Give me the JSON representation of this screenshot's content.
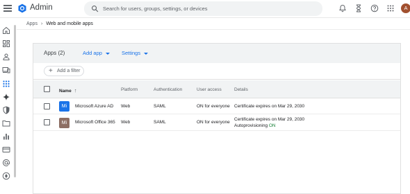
{
  "header": {
    "menu_icon": "hamburger-icon",
    "logo_icon": "google-admin-logo",
    "title": "Admin",
    "search_placeholder": "Search for users, groups, settings, or devices",
    "icons": [
      "notifications-icon",
      "hourglass-icon",
      "help-icon",
      "apps-grid-icon"
    ],
    "avatar_initial": "A"
  },
  "rail": {
    "items": [
      "home-icon",
      "dashboard-icon",
      "users-icon",
      "devices-icon",
      "apps-icon",
      "generative-ai-icon",
      "security-icon",
      "folder-icon",
      "reporting-icon",
      "billing-icon",
      "account-icon",
      "rules-icon"
    ],
    "active_index": 4
  },
  "breadcrumb": {
    "parent": "Apps",
    "current": "Web and mobile apps"
  },
  "card": {
    "apps_count_label": "Apps (2)",
    "add_app_label": "Add app",
    "settings_label": "Settings",
    "add_filter_label": "Add a filter"
  },
  "table": {
    "columns": {
      "name": "Name",
      "platform": "Platform",
      "authentication": "Authentication",
      "user_access": "User access",
      "details": "Details"
    },
    "rows": [
      {
        "icon_text": "Mi",
        "icon_color": "#1a73e8",
        "name": "Microsoft Azure AD",
        "platform": "Web",
        "authentication": "SAML",
        "user_access": "ON for everyone",
        "details": "Certificate expires on Mar 29, 2030",
        "details_extra_label": "",
        "details_extra_value": ""
      },
      {
        "icon_text": "Mi",
        "icon_color": "#8d6e63",
        "name": "Microsoft Office 365",
        "platform": "Web",
        "authentication": "SAML",
        "user_access": "ON for everyone",
        "details": "Certificate expires on Mar 29, 2030",
        "details_extra_label": "Autoprovisioning",
        "details_extra_value": "ON"
      }
    ]
  },
  "colors": {
    "accent": "#1a73e8",
    "status_on": "#188038",
    "header_bg": "#f1f3f4"
  }
}
